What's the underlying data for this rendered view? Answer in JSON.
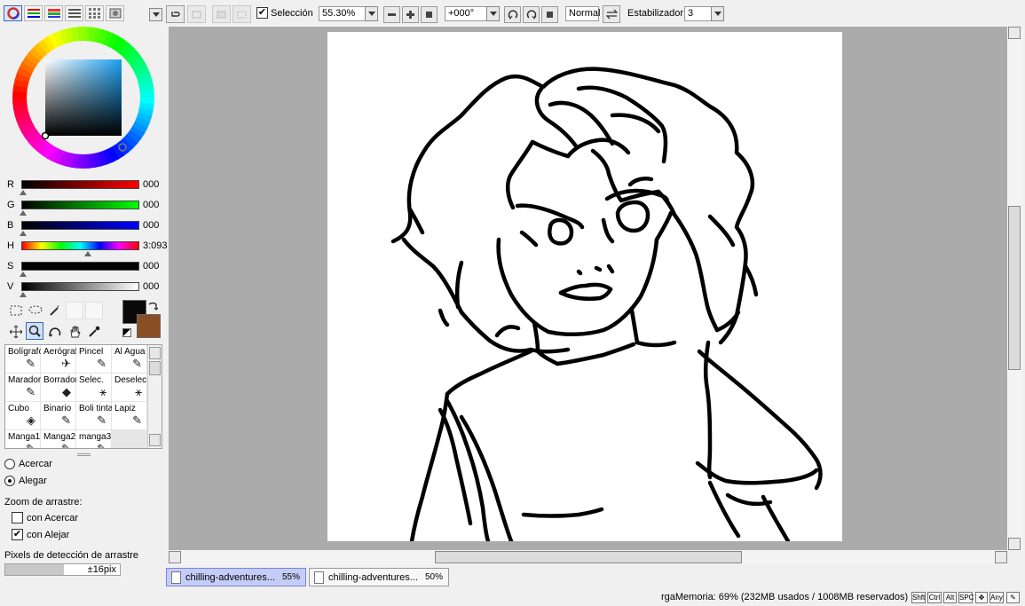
{
  "left_panel": {
    "color_modes": [
      "color-wheel-icon",
      "rgb-sliders-icon",
      "hsv-sliders-icon",
      "palette-list-icon",
      "swatches-icon",
      "scratchpad-icon"
    ],
    "sliders": [
      {
        "label": "R",
        "value": "000",
        "position": 0.0
      },
      {
        "label": "G",
        "value": "000",
        "position": 0.0
      },
      {
        "label": "B",
        "value": "000",
        "position": 0.0
      },
      {
        "label": "H",
        "value": "3:093",
        "position": 0.55
      },
      {
        "label": "S",
        "value": "000",
        "position": 0.0
      },
      {
        "label": "V",
        "value": "000",
        "position": 0.0
      }
    ],
    "primary_color": "#0a0a0a",
    "secondary_color": "#8b4e24",
    "brushes": [
      [
        "Bolígrafo",
        "Aerógrafo",
        "Pincel",
        "Al Agua"
      ],
      [
        "Marador",
        "Borrador",
        "Selec.",
        "Deselec."
      ],
      [
        "Cubo",
        "Binario",
        "Boli tinta",
        "Lapiz"
      ],
      [
        "Manga1",
        "Manga2",
        "manga3",
        ""
      ]
    ],
    "zoom_options": {
      "acercar": "Acercar",
      "alegar": "Alegar"
    },
    "drag_zoom_title": "Zoom de arrastre:",
    "drag_zoom_in": "con Acercar",
    "drag_zoom_out": "con Alejar",
    "drag_pixels_label": "Pixels de detección de arrastre",
    "drag_pixels_value": "±16pix"
  },
  "toolbar": {
    "selection_label": "Selección",
    "zoom": "55.30%",
    "rotation": "+000°",
    "blend_mode": "Normal",
    "stabilizer_label": "Estabilizador",
    "stabilizer_value": "3"
  },
  "tabs": [
    {
      "name": "chilling-adventures...",
      "zoom": "55%",
      "active": true
    },
    {
      "name": "chilling-adventures...",
      "zoom": "50%",
      "active": false
    }
  ],
  "status": {
    "memory": "rgaMemoria: 69% (232MB usados / 1008MB reservados)",
    "keys": [
      "Shft",
      "Ctrl",
      "Alt",
      "SPC",
      "Any"
    ]
  }
}
